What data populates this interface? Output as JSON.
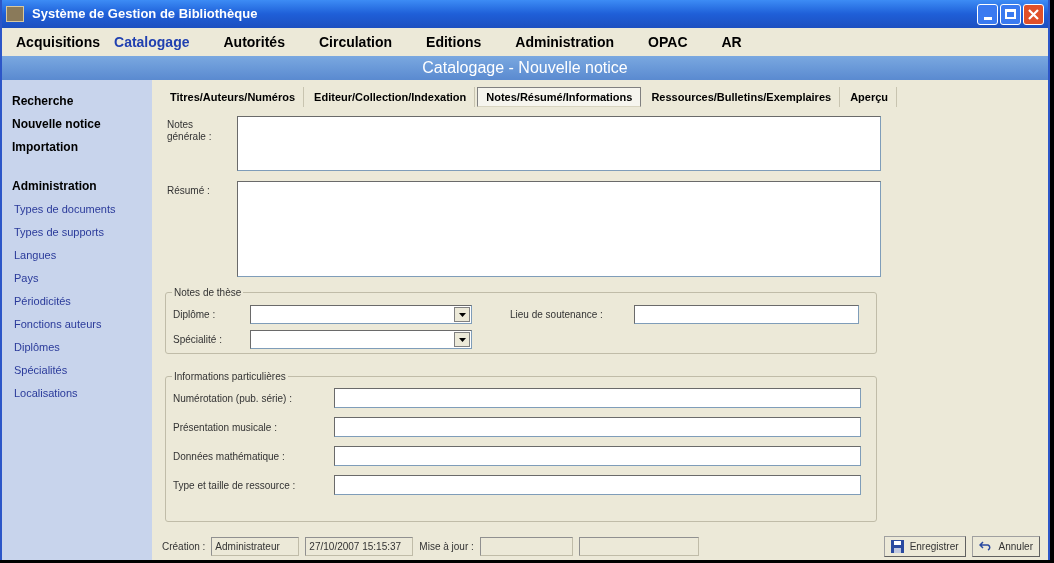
{
  "window": {
    "title": "Système de Gestion de Bibliothèque"
  },
  "menu": [
    {
      "label": "Acquisitions",
      "selected": false
    },
    {
      "label": "Catalogage",
      "selected": true
    },
    {
      "label": "Autorités",
      "selected": false
    },
    {
      "label": "Circulation",
      "selected": false
    },
    {
      "label": "Editions",
      "selected": false
    },
    {
      "label": "Administration",
      "selected": false
    },
    {
      "label": "OPAC",
      "selected": false
    },
    {
      "label": "AR",
      "selected": false
    }
  ],
  "header": "Catalogage - Nouvelle notice",
  "sidebar": [
    {
      "label": "Recherche",
      "kind": "main"
    },
    {
      "label": "Nouvelle notice",
      "kind": "main"
    },
    {
      "label": "Importation",
      "kind": "main"
    },
    {
      "label": "Administration",
      "kind": "heading"
    },
    {
      "label": "Types de documents",
      "kind": "sub"
    },
    {
      "label": "Types de supports",
      "kind": "sub"
    },
    {
      "label": "Langues",
      "kind": "sub"
    },
    {
      "label": "Pays",
      "kind": "sub"
    },
    {
      "label": "Périodicités",
      "kind": "sub"
    },
    {
      "label": "Fonctions auteurs",
      "kind": "sub"
    },
    {
      "label": "Diplômes",
      "kind": "sub"
    },
    {
      "label": "Spécialités",
      "kind": "sub"
    },
    {
      "label": "Localisations",
      "kind": "sub"
    }
  ],
  "tabs": [
    {
      "label": "Titres/Auteurs/Numéros",
      "selected": false
    },
    {
      "label": "Editeur/Collection/Indexation",
      "selected": false
    },
    {
      "label": "Notes/Résumé/Informations",
      "selected": true
    },
    {
      "label": "Ressources/Bulletins/Exemplaires",
      "selected": false
    },
    {
      "label": "Aperçu",
      "selected": false
    }
  ],
  "notes_label": "Notes générale :",
  "resume_label": "Résumé :",
  "thesis": {
    "legend": "Notes de thèse",
    "diplome": "Diplôme :",
    "lieu": "Lieu de soutenance :",
    "specialite": "Spécialité :"
  },
  "info": {
    "legend": "Informations particulières",
    "fields": [
      "Numérotation (pub. série) :",
      "Présentation musicale :",
      "Données mathématique :",
      "Type et taille de ressource :"
    ]
  },
  "status": {
    "creation_label": "Création :",
    "creation_by": "Administrateur",
    "creation_date": "27/10/2007 15:15:37",
    "update_label": "Mise à jour :"
  },
  "buttons": [
    {
      "label": "Enregistrer",
      "kind": "save"
    },
    {
      "label": "Annuler",
      "kind": "cancel"
    }
  ]
}
